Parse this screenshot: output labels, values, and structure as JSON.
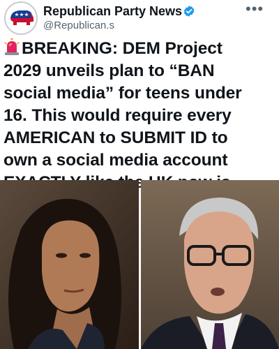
{
  "account": {
    "display_name": "Republican Party News",
    "handle": "@Republican.s",
    "verified": true,
    "avatar_icon": "gop-elephant-icon"
  },
  "menu": {
    "more_label": "•••"
  },
  "post": {
    "siren_icon": "police-siren-emoji",
    "lines": [
      "BREAKING: DEM Project",
      "2029 unveils plan to “BAN",
      "social media” for teens under",
      "16. This would require every",
      "AMERICAN to SUBMIT ID to",
      "own a social media account",
      "EXACTLY like the UK now is"
    ]
  },
  "media": {
    "images": [
      {
        "name": "woman-portrait-photo"
      },
      {
        "name": "man-with-glasses-portrait-photo"
      }
    ]
  },
  "colors": {
    "verified_blue": "#1d9bf0",
    "handle_gray": "#536471",
    "text": "#0f1419",
    "gop_red": "#c8102e",
    "gop_blue": "#1a3a8f"
  }
}
